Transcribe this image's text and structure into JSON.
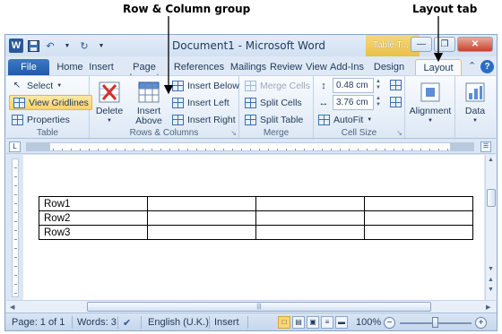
{
  "callouts": {
    "rows_columns_group": "Row & Column group",
    "layout_tab": "Layout tab"
  },
  "titlebar": {
    "title": "Document1  -  Microsoft Word",
    "contextual_label": "Table T...",
    "app_icon": "W"
  },
  "tabs": {
    "file": "File",
    "home": "Home",
    "insert": "Insert",
    "page_layout": "Page Layout",
    "references": "References",
    "mailings": "Mailings",
    "review": "Review",
    "view": "View",
    "addins": "Add-Ins",
    "design": "Design",
    "layout": "Layout"
  },
  "ribbon": {
    "table": {
      "label": "Table",
      "select": "Select",
      "view_gridlines": "View Gridlines",
      "properties": "Properties"
    },
    "rows_columns": {
      "label": "Rows & Columns",
      "delete": "Delete",
      "insert_above_line1": "Insert",
      "insert_above_line2": "Above",
      "insert_below": "Insert Below",
      "insert_left": "Insert Left",
      "insert_right": "Insert Right"
    },
    "merge": {
      "label": "Merge",
      "merge_cells": "Merge Cells",
      "split_cells": "Split Cells",
      "split_table": "Split Table"
    },
    "cell_size": {
      "label": "Cell Size",
      "height": "0.48 cm",
      "width": "3.76 cm",
      "autofit": "AutoFit"
    },
    "alignment": "Alignment",
    "data": "Data"
  },
  "document": {
    "rows": [
      [
        "Row1",
        "",
        "",
        ""
      ],
      [
        "Row2",
        "",
        "",
        ""
      ],
      [
        "Row3",
        "",
        "",
        ""
      ]
    ]
  },
  "status": {
    "page": "Page: 1 of 1",
    "words": "Words: 3",
    "language": "English (U.K.)",
    "mode": "Insert",
    "zoom": "100%"
  },
  "colors": {
    "file_tab": "#2b579a",
    "table_tools": "#e9c04a",
    "highlight": "#f8d46a"
  }
}
